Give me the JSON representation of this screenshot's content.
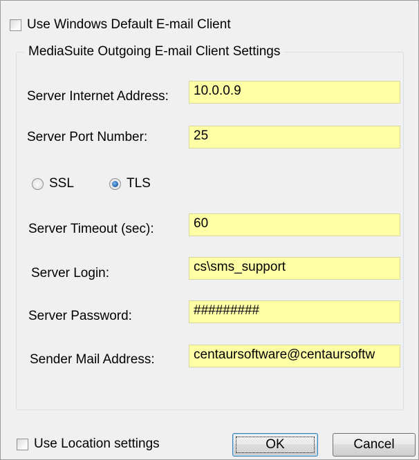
{
  "default_client": {
    "label": "Use Windows Default E-mail Client",
    "checked": false
  },
  "group": {
    "title": "MediaSuite Outgoing E-mail Client Settings",
    "server_address": {
      "label": "Server Internet Address:",
      "value": "10.0.0.9"
    },
    "server_port": {
      "label": "Server Port Number:",
      "value": "25"
    },
    "security": {
      "options": [
        "SSL",
        "TLS"
      ],
      "selected": "TLS"
    },
    "timeout": {
      "label": "Server Timeout (sec):",
      "value": "60"
    },
    "login": {
      "label": "Server Login:",
      "value": "cs\\sms_support"
    },
    "password": {
      "label": "Server Password:",
      "value": "#########"
    },
    "sender": {
      "label": "Sender Mail Address:",
      "value": "centaursoftware@centaursoftw"
    }
  },
  "location": {
    "label": "Use Location settings",
    "checked": false
  },
  "buttons": {
    "ok": "OK",
    "cancel": "Cancel"
  }
}
